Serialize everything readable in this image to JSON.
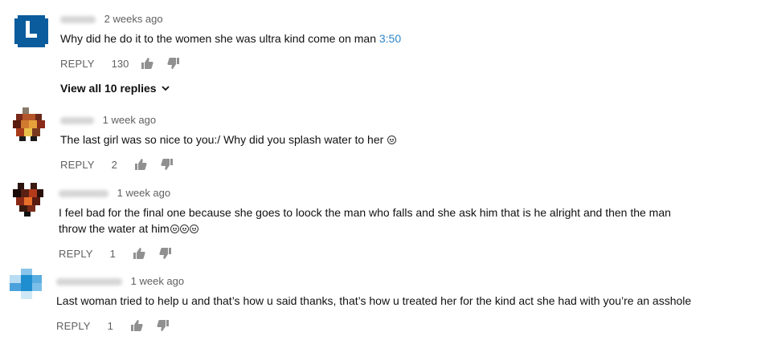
{
  "colors": {
    "timestamp_link": "#2e86c9",
    "meta_gray": "#606060",
    "avatar1": "#0a5c9c",
    "avatar4": "#1e8ed0"
  },
  "labels": {
    "reply": "REPLY",
    "view_replies": "View all 10 replies"
  },
  "comments": [
    {
      "time": "2 weeks ago",
      "text": "Why did he do it to the women she was ultra kind come on man ",
      "timestamp_link": "3:50",
      "likes": "130",
      "avatar_icon": "letter-l-avatar"
    },
    {
      "time": "1 week ago",
      "text": "The last girl was so nice to you:/ Why did you splash water to her ",
      "likes": "2",
      "avatar_icon": "pixel-avatar"
    },
    {
      "time": "1 week ago",
      "text": "I feel bad for the final one because she goes to loock the man who falls and she ask him that is he alright and then the man throw the water at him",
      "likes": "1",
      "avatar_icon": "pixel-avatar"
    },
    {
      "time": "1 week ago",
      "text": "Last woman tried to help u and that’s how u said thanks, that’s how u treated her for the kind act she had with  you’re an asshole",
      "likes": "1",
      "avatar_icon": "pixel-avatar"
    }
  ]
}
